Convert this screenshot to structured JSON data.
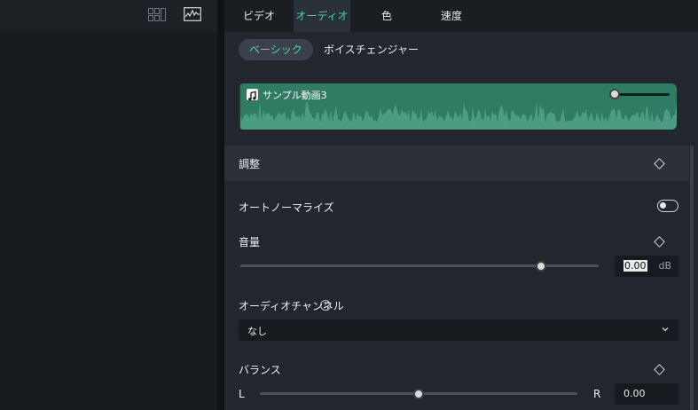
{
  "left_toolbar": {
    "icons": [
      "grid-view-icon",
      "waveform-icon"
    ]
  },
  "tabs": [
    {
      "label": "ビデオ",
      "active": false
    },
    {
      "label": "オーディオ",
      "active": true
    },
    {
      "label": "色",
      "active": false
    },
    {
      "label": "速度",
      "active": false
    }
  ],
  "subtabs": [
    {
      "label": "ベーシック",
      "active": true
    },
    {
      "label": "ボイスチェンジャー",
      "active": false
    }
  ],
  "clip": {
    "title": "サンプル動画3",
    "icon": "music-note-icon",
    "volume": 0.0
  },
  "adjust": {
    "title": "調整"
  },
  "auto_normalize": {
    "label": "オートノーマライズ",
    "enabled": false
  },
  "volume": {
    "label": "音量",
    "value": "0.00",
    "unit": "dB",
    "slider_fraction": 0.84
  },
  "channel": {
    "label": "オーディオチャンネル",
    "help_glyph": "?",
    "selected": "なし"
  },
  "balance": {
    "label": "バランス",
    "left_label": "L",
    "right_label": "R",
    "value": "0.00",
    "slider_fraction": 0.5
  },
  "colors": {
    "accent": "#43d4a8",
    "clip": "#2f7b64",
    "panel": "#22272d"
  }
}
